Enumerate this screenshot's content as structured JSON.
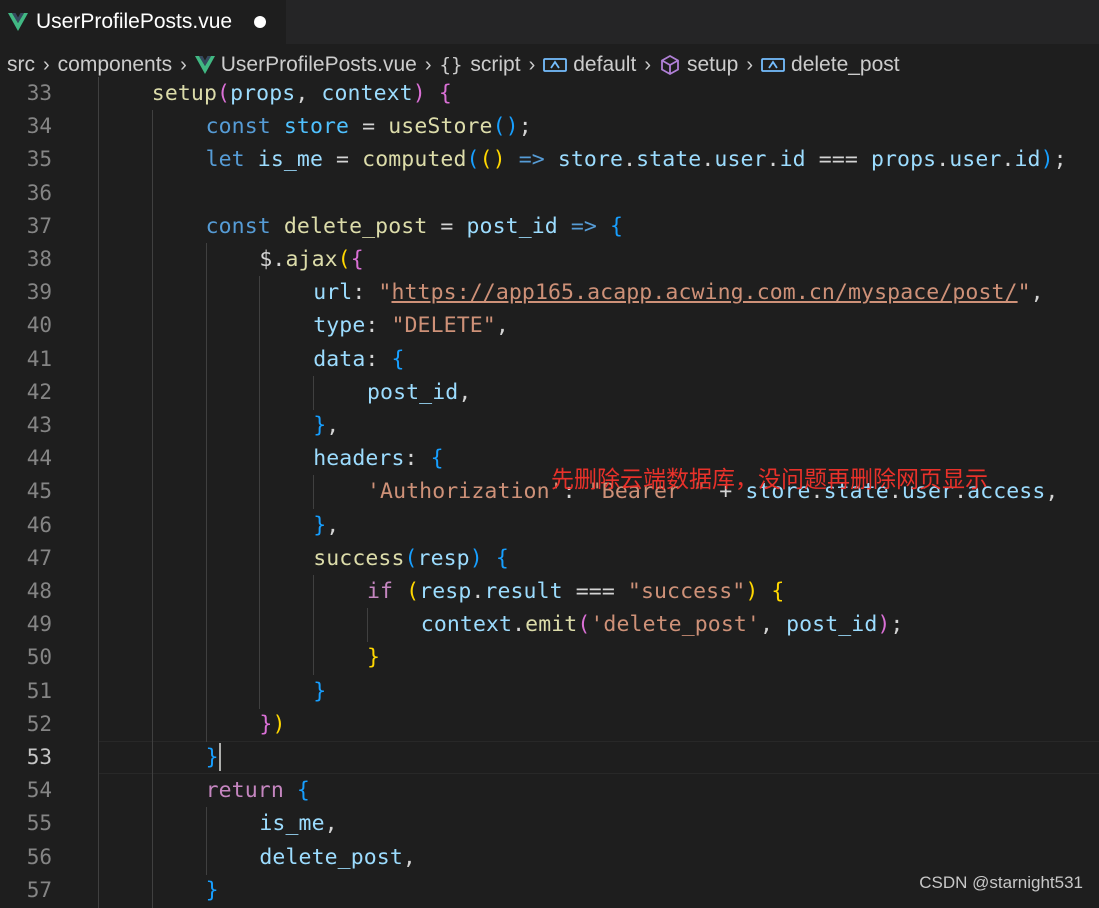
{
  "tab": {
    "filename": "UserProfilePosts.vue",
    "modified": true
  },
  "breadcrumb": {
    "items": [
      "src",
      "components",
      "UserProfilePosts.vue",
      "script",
      "default",
      "setup",
      "delete_post"
    ],
    "braces": "{}"
  },
  "annotation": "先删除云端数据库，没问题再删除网页显示",
  "watermark": "CSDN @starnight531",
  "active_line": 53,
  "lines": [
    {
      "n": 33,
      "indent": 1,
      "tokens": [
        [
          "fn",
          "setup"
        ],
        [
          "b2",
          "("
        ],
        [
          "var",
          "props"
        ],
        [
          "pl",
          ", "
        ],
        [
          "var",
          "context"
        ],
        [
          "b2",
          ")"
        ],
        [
          "pl",
          " "
        ],
        [
          "b2",
          "{"
        ]
      ]
    },
    {
      "n": 34,
      "indent": 2,
      "tokens": [
        [
          "kw",
          "const"
        ],
        [
          "pl",
          " "
        ],
        [
          "cst",
          "store"
        ],
        [
          "pl",
          " = "
        ],
        [
          "fn",
          "useStore"
        ],
        [
          "b3",
          "()"
        ],
        [
          "pl",
          ";"
        ]
      ]
    },
    {
      "n": 35,
      "indent": 2,
      "tokens": [
        [
          "kw",
          "let"
        ],
        [
          "pl",
          " "
        ],
        [
          "var",
          "is_me"
        ],
        [
          "pl",
          " = "
        ],
        [
          "fn",
          "computed"
        ],
        [
          "b3",
          "("
        ],
        [
          "b1",
          "()"
        ],
        [
          "pl",
          " "
        ],
        [
          "kw",
          "=>"
        ],
        [
          "pl",
          " "
        ],
        [
          "var",
          "store"
        ],
        [
          "pl",
          "."
        ],
        [
          "var",
          "state"
        ],
        [
          "pl",
          "."
        ],
        [
          "var",
          "user"
        ],
        [
          "pl",
          "."
        ],
        [
          "var",
          "id"
        ],
        [
          "pl",
          " === "
        ],
        [
          "var",
          "props"
        ],
        [
          "pl",
          "."
        ],
        [
          "var",
          "user"
        ],
        [
          "pl",
          "."
        ],
        [
          "var",
          "id"
        ],
        [
          "b3",
          ")"
        ],
        [
          "pl",
          ";"
        ]
      ]
    },
    {
      "n": 36,
      "indent": 2,
      "tokens": []
    },
    {
      "n": 37,
      "indent": 2,
      "tokens": [
        [
          "kw",
          "const"
        ],
        [
          "pl",
          " "
        ],
        [
          "fn",
          "delete_post"
        ],
        [
          "pl",
          " = "
        ],
        [
          "var",
          "post_id"
        ],
        [
          "pl",
          " "
        ],
        [
          "kw",
          "=>"
        ],
        [
          "pl",
          " "
        ],
        [
          "b3",
          "{"
        ]
      ]
    },
    {
      "n": 38,
      "indent": 3,
      "tokens": [
        [
          "pl",
          "$."
        ],
        [
          "fn",
          "ajax"
        ],
        [
          "b1",
          "("
        ],
        [
          "b2",
          "{"
        ]
      ]
    },
    {
      "n": 39,
      "indent": 4,
      "tokens": [
        [
          "var",
          "url"
        ],
        [
          "pl",
          ": "
        ],
        [
          "str",
          "\""
        ],
        [
          "url",
          "https://app165.acapp.acwing.com.cn/myspace/post/"
        ],
        [
          "str",
          "\""
        ],
        [
          "pl",
          ","
        ]
      ]
    },
    {
      "n": 40,
      "indent": 4,
      "tokens": [
        [
          "var",
          "type"
        ],
        [
          "pl",
          ": "
        ],
        [
          "str",
          "\"DELETE\""
        ],
        [
          "pl",
          ","
        ]
      ]
    },
    {
      "n": 41,
      "indent": 4,
      "tokens": [
        [
          "var",
          "data"
        ],
        [
          "pl",
          ": "
        ],
        [
          "b3",
          "{"
        ]
      ]
    },
    {
      "n": 42,
      "indent": 5,
      "tokens": [
        [
          "var",
          "post_id"
        ],
        [
          "pl",
          ","
        ]
      ]
    },
    {
      "n": 43,
      "indent": 4,
      "tokens": [
        [
          "b3",
          "}"
        ],
        [
          "pl",
          ","
        ]
      ]
    },
    {
      "n": 44,
      "indent": 4,
      "tokens": [
        [
          "var",
          "headers"
        ],
        [
          "pl",
          ": "
        ],
        [
          "b3",
          "{"
        ]
      ]
    },
    {
      "n": 45,
      "indent": 5,
      "tokens": [
        [
          "str",
          "'Authorization'"
        ],
        [
          "pl",
          ": "
        ],
        [
          "str",
          "\"Bearer \""
        ],
        [
          "pl",
          " + "
        ],
        [
          "var",
          "store"
        ],
        [
          "pl",
          "."
        ],
        [
          "var",
          "state"
        ],
        [
          "pl",
          "."
        ],
        [
          "var",
          "user"
        ],
        [
          "pl",
          "."
        ],
        [
          "var",
          "access"
        ],
        [
          "pl",
          ","
        ]
      ]
    },
    {
      "n": 46,
      "indent": 4,
      "tokens": [
        [
          "b3",
          "}"
        ],
        [
          "pl",
          ","
        ]
      ]
    },
    {
      "n": 47,
      "indent": 4,
      "tokens": [
        [
          "fn",
          "success"
        ],
        [
          "b3",
          "("
        ],
        [
          "var",
          "resp"
        ],
        [
          "b3",
          ")"
        ],
        [
          "pl",
          " "
        ],
        [
          "b3",
          "{"
        ]
      ]
    },
    {
      "n": 48,
      "indent": 5,
      "tokens": [
        [
          "ctl",
          "if"
        ],
        [
          "pl",
          " "
        ],
        [
          "b1",
          "("
        ],
        [
          "var",
          "resp"
        ],
        [
          "pl",
          "."
        ],
        [
          "var",
          "result"
        ],
        [
          "pl",
          " === "
        ],
        [
          "str",
          "\"success\""
        ],
        [
          "b1",
          ")"
        ],
        [
          "pl",
          " "
        ],
        [
          "b1",
          "{"
        ]
      ]
    },
    {
      "n": 49,
      "indent": 6,
      "tokens": [
        [
          "var",
          "context"
        ],
        [
          "pl",
          "."
        ],
        [
          "fn",
          "emit"
        ],
        [
          "b2",
          "("
        ],
        [
          "str",
          "'delete_post'"
        ],
        [
          "pl",
          ", "
        ],
        [
          "var",
          "post_id"
        ],
        [
          "b2",
          ")"
        ],
        [
          "pl",
          ";"
        ]
      ]
    },
    {
      "n": 50,
      "indent": 5,
      "tokens": [
        [
          "b1",
          "}"
        ]
      ]
    },
    {
      "n": 51,
      "indent": 4,
      "tokens": [
        [
          "b3",
          "}"
        ]
      ]
    },
    {
      "n": 52,
      "indent": 3,
      "tokens": [
        [
          "b2",
          "}"
        ],
        [
          "b1",
          ")"
        ]
      ]
    },
    {
      "n": 53,
      "indent": 2,
      "tokens": [
        [
          "b3",
          "}"
        ]
      ]
    },
    {
      "n": 54,
      "indent": 2,
      "tokens": [
        [
          "ctl",
          "return"
        ],
        [
          "pl",
          " "
        ],
        [
          "b3",
          "{"
        ]
      ]
    },
    {
      "n": 55,
      "indent": 3,
      "tokens": [
        [
          "var",
          "is_me"
        ],
        [
          "pl",
          ","
        ]
      ]
    },
    {
      "n": 56,
      "indent": 3,
      "tokens": [
        [
          "var",
          "delete_post"
        ],
        [
          "pl",
          ","
        ]
      ]
    },
    {
      "n": 57,
      "indent": 2,
      "tokens": [
        [
          "b3",
          "}"
        ]
      ]
    }
  ],
  "colors": {
    "background": "#1e1e1e",
    "keyword": "#569cd6",
    "function": "#dcdcaa",
    "variable": "#9cdcfe",
    "string": "#ce9178",
    "annotation": "#e8312a"
  }
}
